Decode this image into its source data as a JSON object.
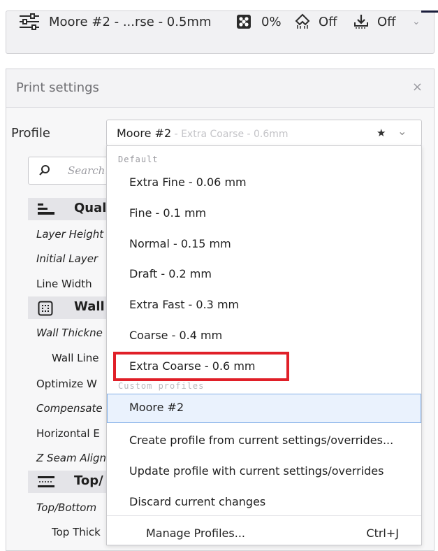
{
  "toolbar": {
    "printer_label": "Moore #2 - ...rse - 0.5mm",
    "infill_value": "0%",
    "support_value": "Off",
    "adhesion_value": "Off"
  },
  "panel": {
    "title": "Print settings",
    "close_glyph": "×"
  },
  "profile": {
    "label": "Profile",
    "current_name": "Moore #2",
    "current_sub": " - Extra Coarse - 0.6mm"
  },
  "search": {
    "placeholder": "Search..."
  },
  "categories": [
    {
      "name": "Qual",
      "icon": "quality-icon"
    },
    {
      "name": "Wall",
      "icon": "walls-icon"
    },
    {
      "name": "Top/",
      "icon": "top-bottom-icon"
    }
  ],
  "settings": [
    "Layer Height",
    "Initial Layer",
    "Line Width",
    "Wall Thickne",
    "Wall Line",
    "Optimize W",
    "Compensate",
    "Horizontal E",
    "Z Seam Align",
    "Top/Bottom",
    "Top Thick"
  ],
  "dropdown": {
    "default_header": "Default",
    "default_items": [
      "Extra Fine - 0.06 mm",
      "Fine - 0.1 mm",
      "Normal - 0.15 mm",
      "Draft - 0.2 mm",
      "Extra Fast - 0.3 mm",
      "Coarse - 0.4 mm",
      "Extra Coarse - 0.6 mm"
    ],
    "custom_header": "Custom profiles",
    "custom_items": [
      "Moore #2"
    ],
    "actions": [
      "Create profile from current settings/overrides...",
      "Update profile with current settings/overrides",
      "Discard current changes"
    ],
    "manage_label": "Manage Profiles...",
    "manage_shortcut": "Ctrl+J"
  },
  "colors": {
    "highlight_box": "#e01f28",
    "selected_bg": "#eaf2fd",
    "selected_border": "#84b0e8"
  }
}
